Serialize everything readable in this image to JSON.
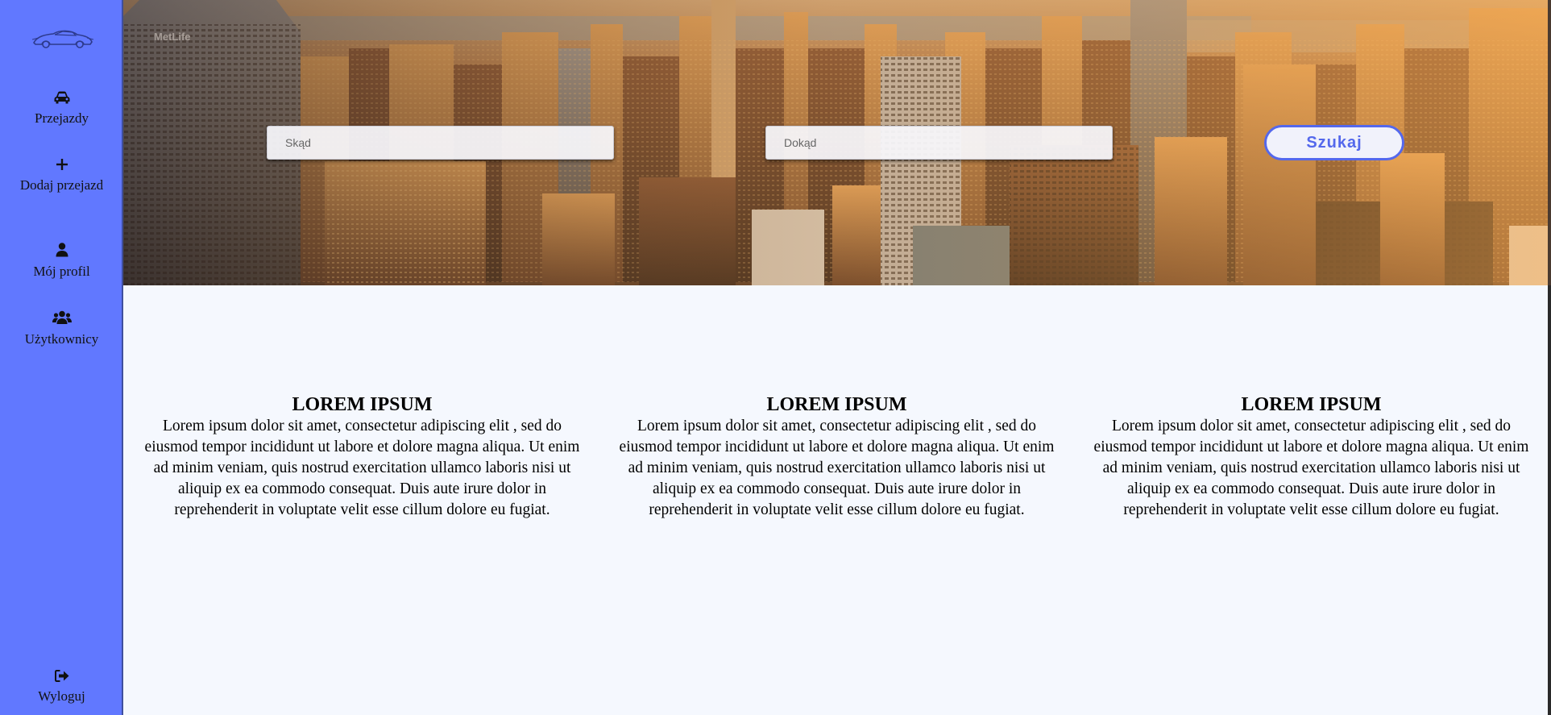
{
  "sidebar": {
    "logo_icon": "car-logo-icon",
    "items": [
      {
        "label": "Przejazdy",
        "icon": "car-icon"
      },
      {
        "label": "Dodaj przejazd",
        "icon": "plus-icon"
      },
      {
        "label": "Mój profil",
        "icon": "user-icon"
      },
      {
        "label": "Użytkownicy",
        "icon": "users-icon"
      }
    ],
    "logout": {
      "label": "Wyloguj",
      "icon": "sign-out-icon"
    }
  },
  "search": {
    "from_placeholder": "Skąd",
    "to_placeholder": "Dokąd",
    "from_value": "",
    "to_value": "",
    "button_label": "Szukaj"
  },
  "columns": [
    {
      "title": "LOREM IPSUM",
      "text": "Lorem ipsum dolor sit amet, consectetur adipiscing elit , sed do eiusmod tempor incididunt ut labore et dolore magna aliqua. Ut enim ad minim veniam, quis nostrud exercitation ullamco laboris nisi ut aliquip ex ea commodo consequat. Duis aute irure dolor in reprehenderit in voluptate velit esse cillum dolore eu fugiat."
    },
    {
      "title": "LOREM IPSUM",
      "text": "Lorem ipsum dolor sit amet, consectetur adipiscing elit , sed do eiusmod tempor incididunt ut labore et dolore magna aliqua. Ut enim ad minim veniam, quis nostrud exercitation ullamco laboris nisi ut aliquip ex ea commodo consequat. Duis aute irure dolor in reprehenderit in voluptate velit esse cillum dolore eu fugiat."
    },
    {
      "title": "LOREM IPSUM",
      "text": "Lorem ipsum dolor sit amet, consectetur adipiscing elit , sed do eiusmod tempor incididunt ut labore et dolore magna aliqua. Ut enim ad minim veniam, quis nostrud exercitation ullamco laboris nisi ut aliquip ex ea commodo consequat. Duis aute irure dolor in reprehenderit in voluptate velit esse cillum dolore eu fugiat."
    }
  ],
  "colors": {
    "sidebar": "#6178ff",
    "accent": "#5468ec",
    "content_bg": "#f5f8fe"
  }
}
